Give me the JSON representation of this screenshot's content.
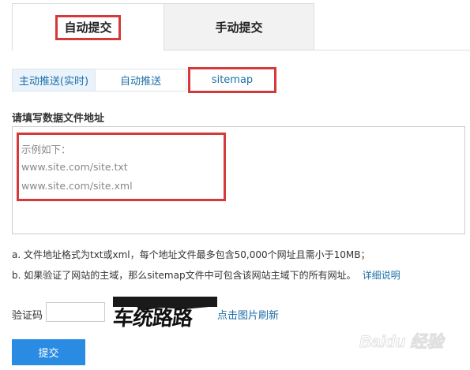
{
  "top_tabs": [
    {
      "label": "自动提交",
      "active": true
    },
    {
      "label": "手动提交",
      "active": false
    }
  ],
  "sub_tabs": [
    {
      "label": "主动推送(实时)"
    },
    {
      "label": "自动推送"
    },
    {
      "label": "sitemap",
      "active": true
    }
  ],
  "section_title": "请填写数据文件地址",
  "textarea": {
    "placeholder_lines": [
      "示例如下：",
      "www.site.com/site.txt",
      "www.site.com/site.xml"
    ]
  },
  "notes": {
    "a": "a. 文件地址格式为txt或xml，每个地址文件最多包含50,000个网址且需小于10MB；",
    "b": "b. 如果验证了网站的主域，那么sitemap文件中可包含该网站主域下的所有网址。",
    "detail_link": "详细说明"
  },
  "captcha": {
    "label": "验证码",
    "input_value": "",
    "image_text": "车统路路",
    "refresh_label": "点击图片刷新"
  },
  "submit_label": "提交",
  "watermark_text": "Baidu 经验",
  "colors": {
    "highlight_red": "#d43a3a",
    "link_blue": "#1d6fa8",
    "submit_blue": "#2a8be3"
  }
}
